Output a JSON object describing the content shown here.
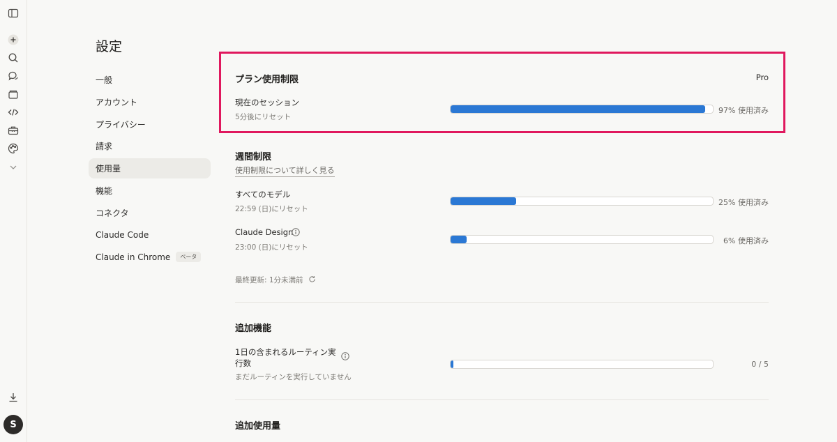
{
  "settings": {
    "title": "設定"
  },
  "nav": {
    "general": "一般",
    "account": "アカウント",
    "privacy": "プライバシー",
    "billing": "請求",
    "usage": "使用量",
    "features": "機能",
    "connectors": "コネクタ",
    "claude_code": "Claude Code",
    "claude_in_chrome": "Claude in Chrome",
    "beta_badge": "ベータ"
  },
  "plan": {
    "title": "プラン使用制限",
    "badge": "Pro",
    "session_label": "現在のセッション",
    "session_reset": "5分後にリセット",
    "session_percent": 97,
    "session_pct_text": "97% 使用済み"
  },
  "weekly": {
    "title": "週間制限",
    "learn_more": "使用制限について詳しく見る",
    "all_models_label": "すべてのモデル",
    "all_models_reset": "22:59 (日)にリセット",
    "all_models_percent": 25,
    "all_models_pct_text": "25% 使用済み",
    "design_label": "Claude Design",
    "design_reset": "23:00 (日)にリセット",
    "design_percent": 6,
    "design_pct_text": "6% 使用済み",
    "last_updated": "最終更新: 1分未満前"
  },
  "additional": {
    "title": "追加機能",
    "routines_label_line1": "1日の含まれるルーティン実",
    "routines_label_line2": "行数",
    "routines_sub": "まだルーティンを実行していません",
    "routines_used": 0,
    "routines_total": 5,
    "routines_count": "0 / 5"
  },
  "extra_usage": {
    "title": "追加使用量"
  },
  "user": {
    "initial": "S"
  },
  "icons": {
    "rail": [
      "sidebar-toggle-icon",
      "new-chat-icon",
      "search-icon",
      "chats-icon",
      "projects-icon",
      "code-icon",
      "toolbox-icon",
      "palette-icon",
      "chevron-down-icon",
      "download-icon"
    ],
    "info": "info-icon",
    "refresh": "refresh-icon"
  },
  "colors": {
    "accent": "#2b78d4",
    "highlight": "#e0185e",
    "background": "#f8f8f6"
  }
}
